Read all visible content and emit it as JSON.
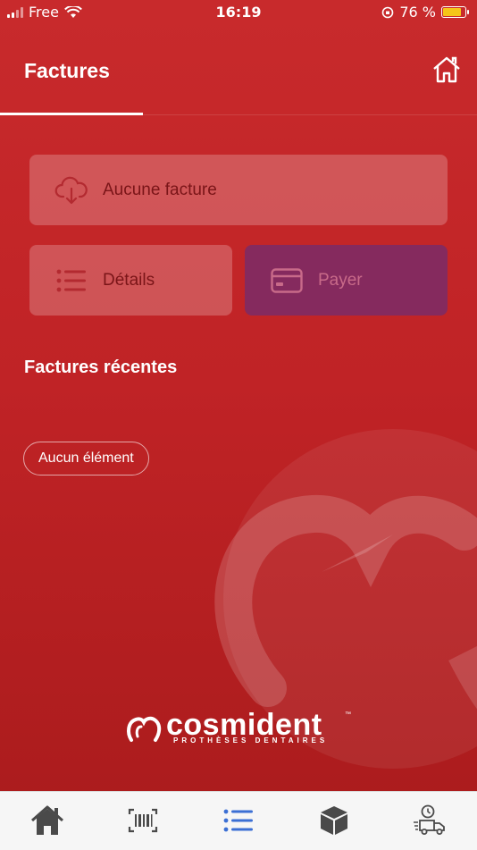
{
  "status_bar": {
    "carrier": "Free",
    "time": "16:19",
    "battery": "76 %",
    "battery_level": 0.76
  },
  "header": {
    "title": "Factures"
  },
  "actions": {
    "download_label": "Aucune facture",
    "details_label": "Détails",
    "pay_label": "Payer"
  },
  "recent": {
    "title": "Factures récentes",
    "empty_label": "Aucun élément"
  },
  "brand": {
    "name": "cosmident",
    "tm": "™",
    "tagline": "PROTHÈSES DENTAIRES"
  },
  "colors": {
    "primary": "#c02326",
    "pay_button": "#852a5e",
    "nav_active": "#3b6fd4",
    "nav_inactive": "#4a4a4a"
  },
  "bottom_nav": [
    {
      "icon": "home-icon"
    },
    {
      "icon": "barcode-icon"
    },
    {
      "icon": "list-icon",
      "active": true
    },
    {
      "icon": "box-icon"
    },
    {
      "icon": "delivery-truck-icon"
    }
  ]
}
